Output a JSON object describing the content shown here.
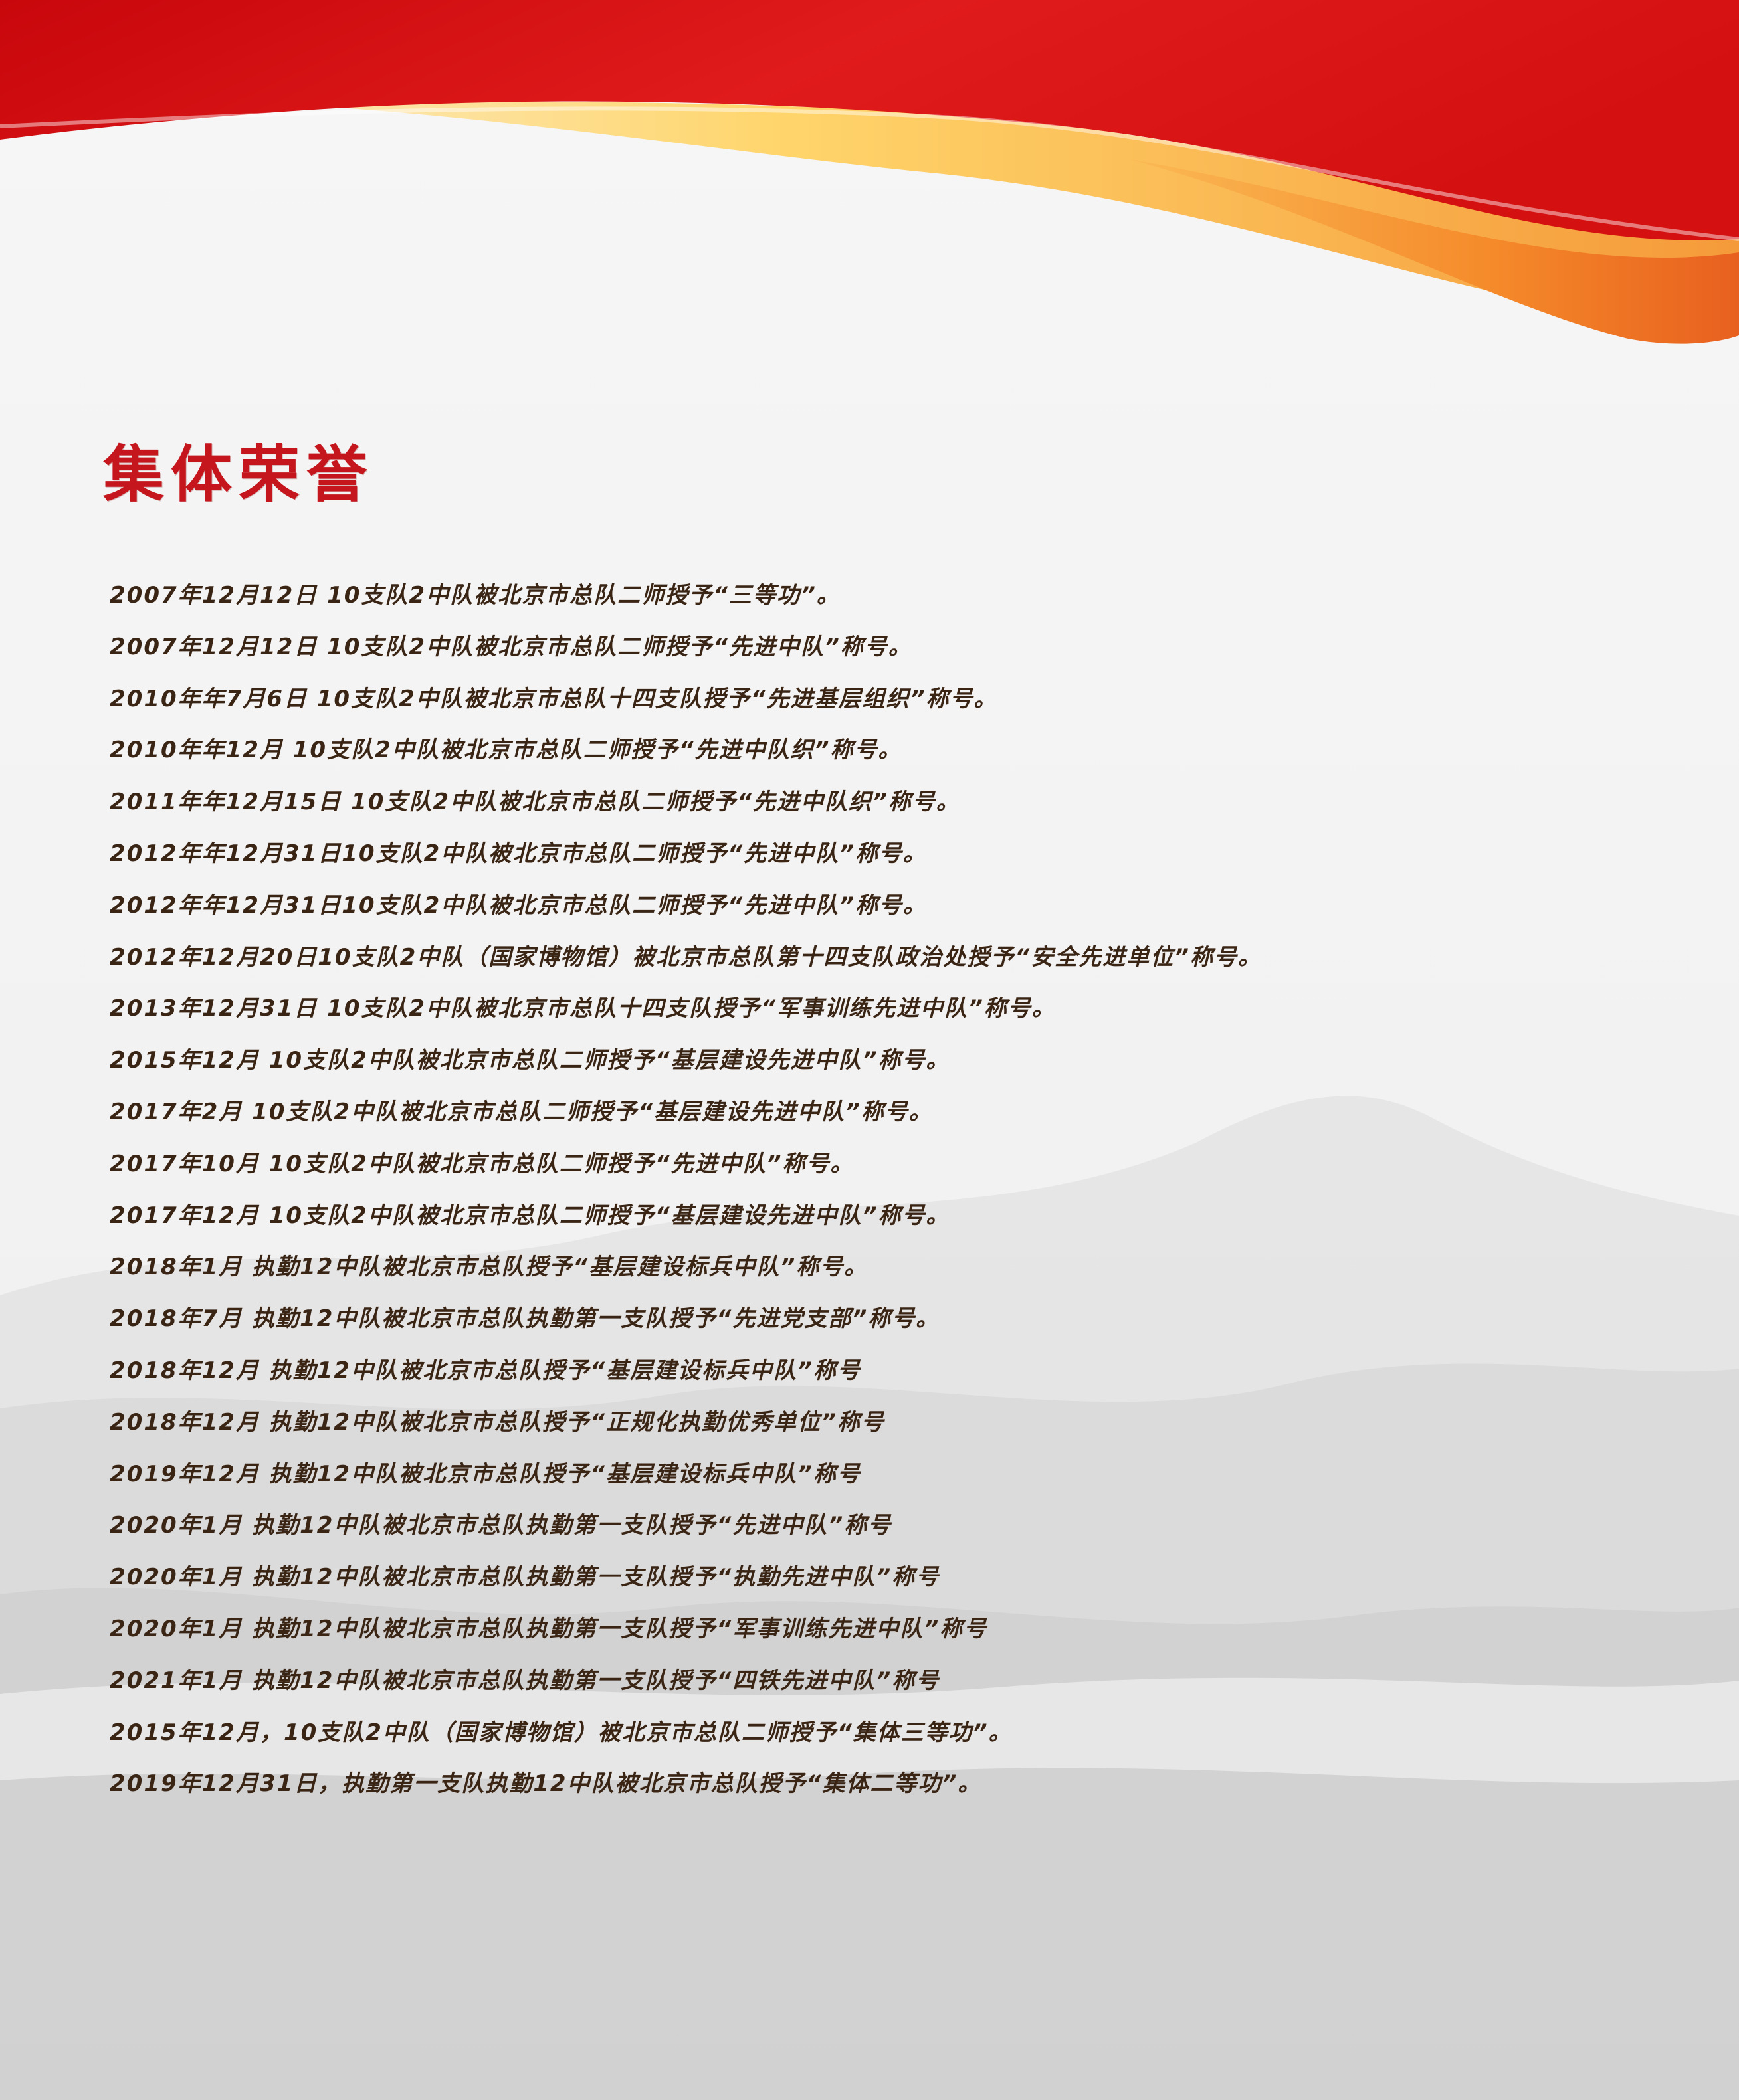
{
  "page": {
    "title": "集体荣誉",
    "title_color": "#c4161c",
    "text_color": "#3a2414"
  },
  "honors": [
    "2007年12月12日 10支队2中队被北京市总队二师授予“三等功”。",
    "2007年12月12日 10支队2中队被北京市总队二师授予“先进中队”称号。",
    "2010年年7月6日 10支队2中队被北京市总队十四支队授予“先进基层组织”称号。",
    "2010年年12月 10支队2中队被北京市总队二师授予“先进中队织”称号。",
    "2011年年12月15日 10支队2中队被北京市总队二师授予“先进中队织”称号。",
    "2012年年12月31日10支队2中队被北京市总队二师授予“先进中队”称号。",
    "2012年年12月31日10支队2中队被北京市总队二师授予“先进中队”称号。",
    "2012年12月20日10支队2中队（国家博物馆）被北京市总队第十四支队政治处授予“安全先进单位”称号。",
    "2013年12月31日 10支队2中队被北京市总队十四支队授予“军事训练先进中队”称号。",
    "2015年12月 10支队2中队被北京市总队二师授予“基层建设先进中队”称号。",
    "2017年2月 10支队2中队被北京市总队二师授予“基层建设先进中队”称号。",
    "2017年10月 10支队2中队被北京市总队二师授予“先进中队”称号。",
    "2017年12月 10支队2中队被北京市总队二师授予“基层建设先进中队”称号。",
    "2018年1月 执勤12中队被北京市总队授予“基层建设标兵中队”称号。",
    "2018年7月 执勤12中队被北京市总队执勤第一支队授予“先进党支部”称号。",
    "2018年12月 执勤12中队被北京市总队授予“基层建设标兵中队”称号",
    "2018年12月 执勤12中队被北京市总队授予“正规化执勤优秀单位”称号",
    "2019年12月 执勤12中队被北京市总队授予“基层建设标兵中队”称号",
    "2020年1月 执勤12中队被北京市总队执勤第一支队授予“先进中队”称号",
    "2020年1月 执勤12中队被北京市总队执勤第一支队授予“执勤先进中队”称号",
    "2020年1月 执勤12中队被北京市总队执勤第一支队授予“军事训练先进中队”称号",
    "2021年1月 执勤12中队被北京市总队执勤第一支队授予“四铁先进中队”称号",
    "2015年12月，10支队2中队（国家博物馆）被北京市总队二师授予“集体三等功”。",
    "2019年12月31日，执勤第一支队执勤12中队被北京市总队授予“集体二等功”。"
  ]
}
